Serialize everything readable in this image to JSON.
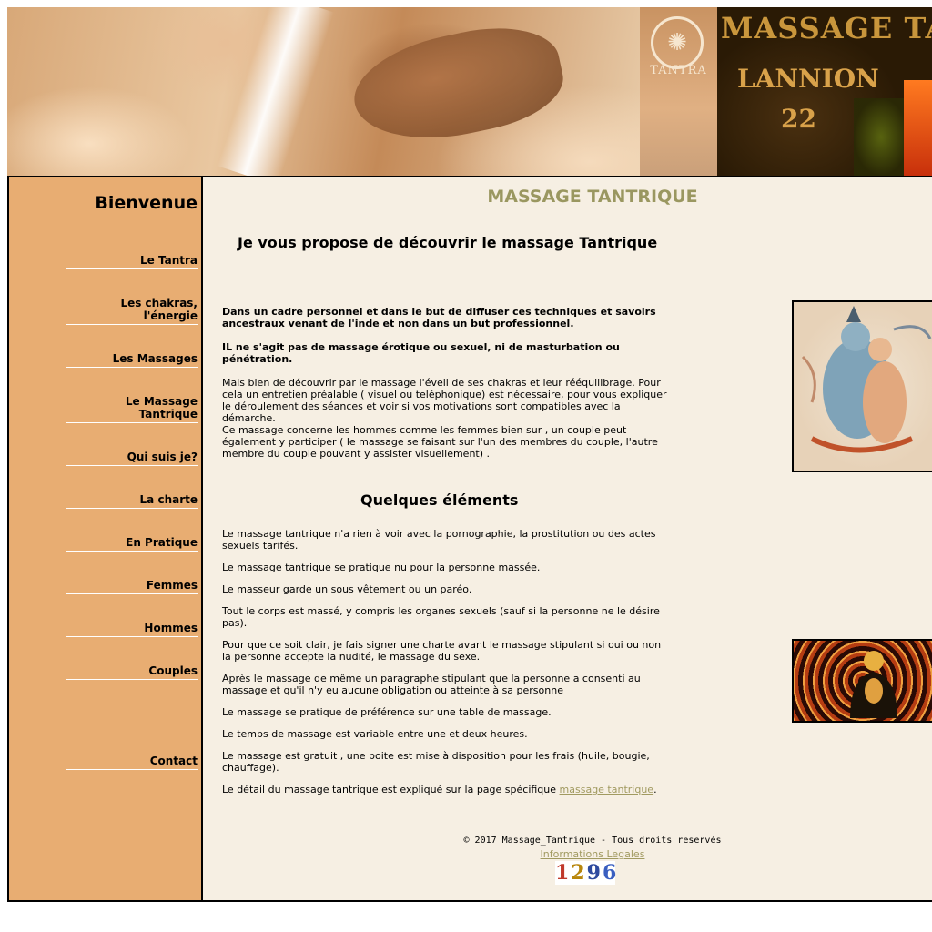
{
  "banner": {
    "tantra_label": "TANTRA",
    "title": "MASSAGE TANTRIQUE",
    "city": "LANNION",
    "department": "22"
  },
  "nav": {
    "welcome": "Bienvenue",
    "items": [
      "Le Tantra",
      "Les chakras, l'énergie",
      "Les Massages",
      "Le Massage Tantrique",
      "Qui suis je?",
      "La charte",
      "En Pratique",
      "Femmes",
      "Hommes",
      "Couples",
      "Contact"
    ]
  },
  "main": {
    "site_heading": "MASSAGE TANTRIQUE",
    "intro_heading": "Je vous propose de découvrir le massage Tantrique",
    "p1": "Dans un cadre personnel et dans le but de diffuser ces techniques et savoirs ancestraux venant de l'inde et non dans un but professionnel.",
    "p2": "IL ne s'agit pas de massage érotique ou sexuel, ni de masturbation ou pénétration.",
    "p3": "Mais bien de découvrir par le massage l'éveil de ses chakras et leur rééquilibrage. Pour cela un entretien préalable ( visuel ou teléphonique) est nécessaire, pour vous expliquer le déroulement des séances et voir si vos motivations sont compatibles avec la démarche.",
    "p4": "Ce massage concerne les hommes comme les femmes bien sur , un couple peut également y participer ( le massage se faisant sur l'un des membres du couple, l'autre membre du couple pouvant y assister visuellement) .",
    "section_heading": "Quelques éléments",
    "items": [
      "Le massage tantrique n'a rien à voir avec la pornographie, la prostitution ou des actes sexuels tarifés.",
      "Le massage tantrique se pratique nu pour la personne massée.",
      "Le masseur garde un sous vêtement ou un paréo.",
      "Tout le corps est massé, y compris les organes sexuels (sauf si la personne ne le désire pas).",
      "Pour que ce soit clair, je fais signer une charte avant le massage stipulant si oui ou non la personne accepte la nudité, le massage du sexe.",
      "Après le massage de même un paragraphe stipulant que la personne a consenti au massage et qu'il n'y eu aucune obligation ou atteinte à sa personne",
      "Le massage se pratique de préférence sur une table de massage.",
      "Le temps de massage est variable entre une et deux heures.",
      "Le massage est gratuit , une boite est mise à disposition pour les frais (huile, bougie, chauffage)."
    ],
    "last_prefix": "Le détail du massage tantrique est expliqué sur la page spécifique ",
    "last_link": "massage tantrique",
    "last_suffix": "."
  },
  "footer": {
    "copyright": "© 2017 Massage_Tantrique - Tous droits reservés",
    "legal_link": "Informations Legales",
    "counter": "1296"
  },
  "colors": {
    "sidebar_bg": "#e8ad72",
    "content_bg": "#f6efe3",
    "heading_accent": "#9a9760",
    "link": "#a19a60"
  }
}
